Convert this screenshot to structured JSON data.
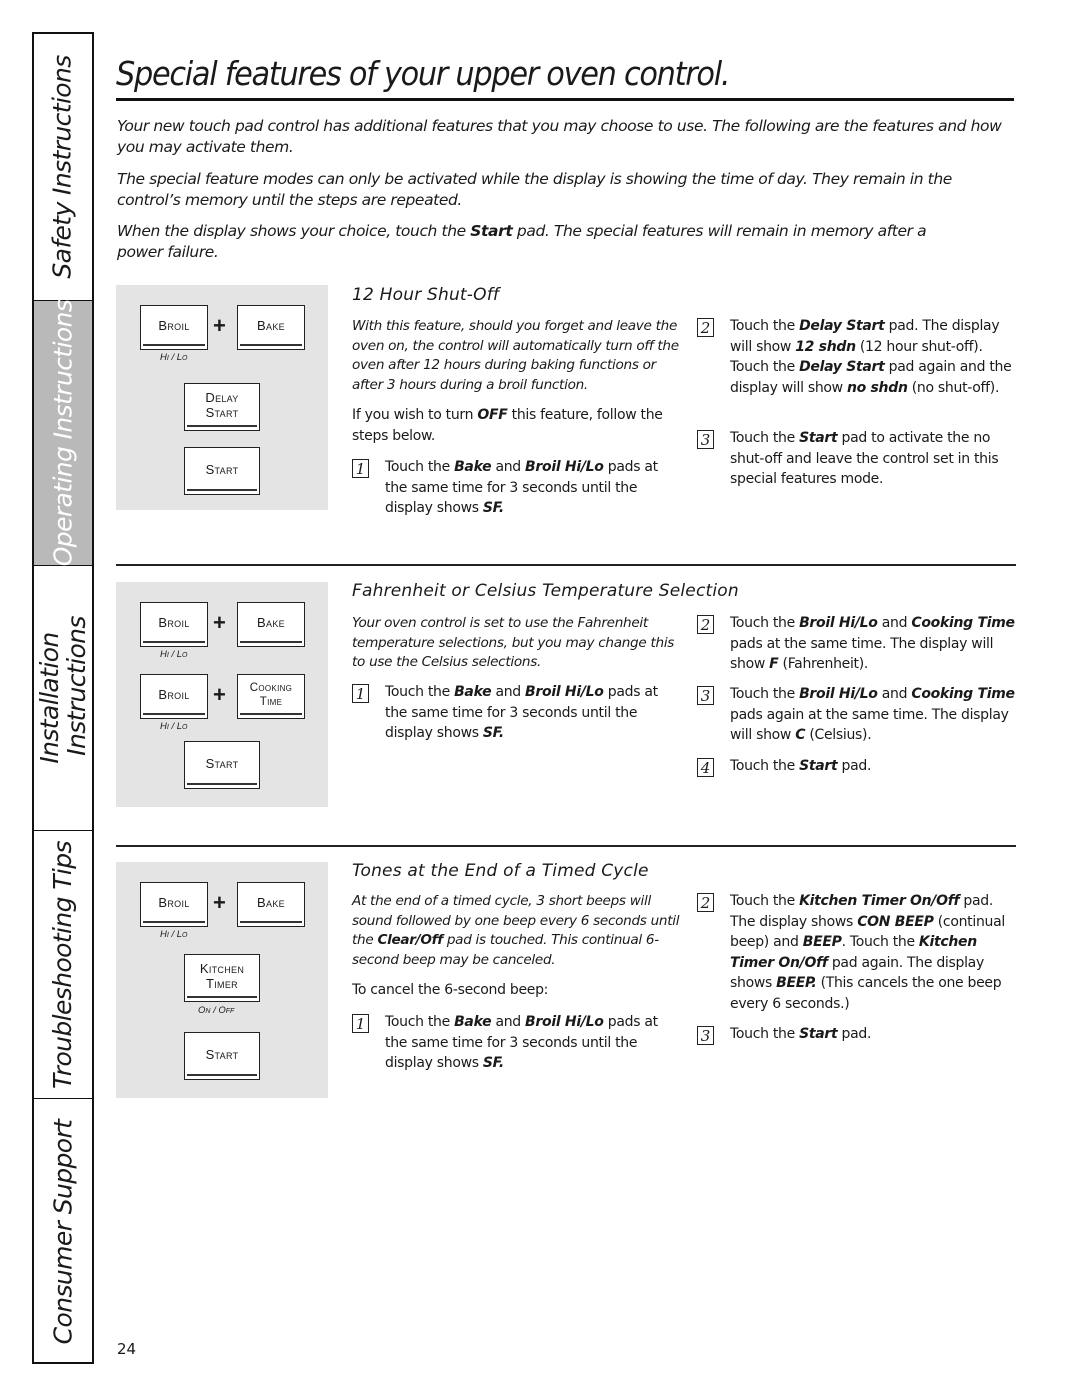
{
  "sidebar": {
    "tabs": [
      {
        "label": "Safety Instructions",
        "active": false
      },
      {
        "label": "Operating Instructions",
        "active": true
      },
      {
        "label_line1": "Installation",
        "label_line2": "Instructions",
        "active": false
      },
      {
        "label": "Troubleshooting Tips",
        "active": false
      },
      {
        "label": "Consumer Support",
        "active": false
      }
    ]
  },
  "page": {
    "title": "Special features of your upper oven control.",
    "intro": [
      {
        "text": "Your new touch pad control has additional features that you may choose to use. The following are the features and how you may activate them."
      },
      {
        "text": "The special feature modes can only be activated while the display is showing the time of day. They remain in the control’s memory until the steps are repeated."
      },
      {
        "before": "When the display shows your choice, touch the ",
        "bold": "Start",
        "after": " pad. The special features will remain in memory after a power failure."
      }
    ],
    "page_number": "24"
  },
  "sections": [
    {
      "heading": "12 Hour Shut-Off",
      "pads": {
        "broil": "Broil",
        "broil_sub": "Hi / Lo",
        "plus": "+",
        "bake": "Bake",
        "delay_l1": "Delay",
        "delay_l2": "Start",
        "start": "Start"
      },
      "description": "With this feature, should you forget and leave the oven on, the control will automatically turn off the oven after 12 hours during baking functions or after 3 hours during a broil function.",
      "note": {
        "before": "If you wish to turn ",
        "bold": "OFF",
        "after": " this feature, follow the steps below."
      },
      "steps": [
        {
          "num": "1",
          "parts": [
            "Touch the ",
            "Bake",
            " and ",
            "Broil Hi/Lo",
            " pads at the same time for 3 seconds until the display shows ",
            "SF."
          ]
        },
        {
          "num": "2",
          "parts": [
            "Touch the ",
            "Delay Start",
            " pad. The display will show ",
            "12 shdn",
            " (12 hour shut-off). Touch the ",
            "Delay Start",
            " pad again and the display will show ",
            "no shdn",
            " (no shut-off)."
          ]
        },
        {
          "num": "3",
          "parts": [
            "Touch the ",
            "Start",
            " pad to activate the no shut-off and leave the control set in this special features mode."
          ]
        }
      ]
    },
    {
      "heading": "Fahrenheit or Celsius Temperature Selection",
      "pads": {
        "broil": "Broil",
        "broil_sub": "Hi / Lo",
        "plus": "+",
        "bake": "Bake",
        "broil2": "Broil",
        "broil2_sub": "Hi / Lo",
        "plus2": "+",
        "cooking_l1": "Cooking",
        "cooking_l2": "Time",
        "start": "Start"
      },
      "description": "Your oven control is set to use the Fahrenheit temperature selections, but you may change this to use the Celsius selections.",
      "steps": [
        {
          "num": "1",
          "parts": [
            "Touch the ",
            "Bake",
            " and ",
            "Broil Hi/Lo",
            " pads at the same time for 3 seconds until the display shows ",
            "SF."
          ]
        },
        {
          "num": "2",
          "parts": [
            "Touch the ",
            "Broil Hi/Lo",
            " and ",
            "Cooking Time",
            " pads at the same time. The display will show ",
            "F",
            " (Fahrenheit)."
          ]
        },
        {
          "num": "3",
          "parts": [
            "Touch the ",
            "Broil Hi/Lo",
            " and ",
            "Cooking Time",
            " pads again at the same time. The display will show ",
            "C",
            " (Celsius)."
          ]
        },
        {
          "num": "4",
          "parts": [
            "Touch the ",
            "Start",
            " pad.",
            "",
            "",
            ""
          ]
        }
      ]
    },
    {
      "heading": "Tones at the End of a Timed Cycle",
      "pads": {
        "broil": "Broil",
        "broil_sub": "Hi / Lo",
        "plus": "+",
        "bake": "Bake",
        "kitchen_l1": "Kitchen",
        "kitchen_l2": "Timer",
        "kitchen_sub": "On / Off",
        "start": "Start"
      },
      "description": {
        "before": "At the end of a timed cycle, 3 short beeps will sound followed by one beep every 6 seconds until the ",
        "bold": "Clear/Off",
        "after": " pad is touched. This continual 6-second beep may be canceled."
      },
      "note": "To cancel the 6-second beep:",
      "steps": [
        {
          "num": "1",
          "parts": [
            "Touch the ",
            "Bake",
            " and ",
            "Broil Hi/Lo",
            " pads at the same time for 3 seconds until the display shows ",
            "SF."
          ]
        },
        {
          "num": "2",
          "parts": [
            "Touch the ",
            "Kitchen Timer On/Off",
            " pad. The display shows ",
            "CON BEEP",
            " (continual beep) and ",
            "BEEP",
            ". Touch the ",
            "Kitchen Timer On/Off",
            " pad again. The display shows ",
            "BEEP.",
            " (This cancels the one beep every 6 seconds.)"
          ]
        },
        {
          "num": "3",
          "parts": [
            "Touch the ",
            "Start",
            " pad.",
            "",
            "",
            ""
          ]
        }
      ]
    }
  ]
}
